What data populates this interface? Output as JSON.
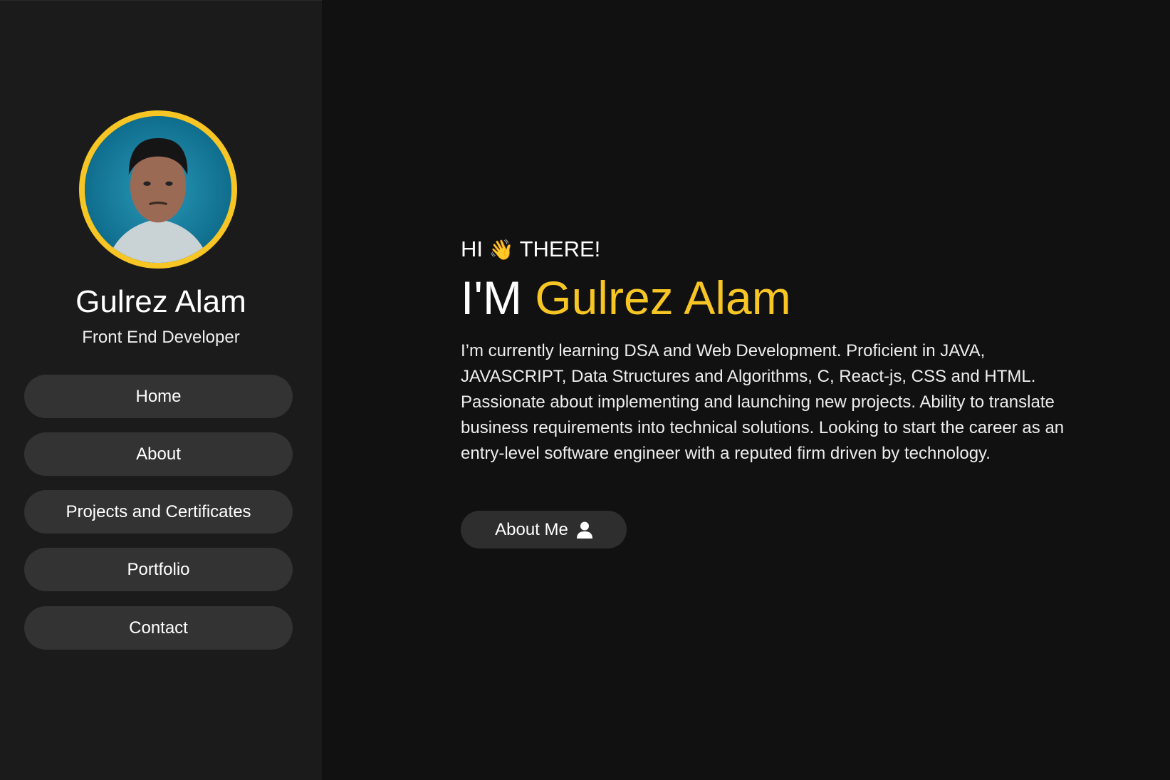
{
  "sidebar": {
    "name": "Gulrez Alam",
    "role": "Front End Developer",
    "nav": [
      "Home",
      "About",
      "Projects and Certificates",
      "Portfolio",
      "Contact"
    ]
  },
  "hero": {
    "greeting_start": "HI",
    "greeting_emoji": "👋",
    "greeting_end": "THERE!",
    "im": "I'M",
    "highlight_name": "Gulrez Alam",
    "description": "I’m currently learning DSA and Web Development. Proficient in JAVA, JAVASCRIPT, Data Structures and Algorithms, C, React-js, CSS and HTML. Passionate about implementing and launching new projects. Ability to translate business requirements into technical solutions. Looking to start the career as an entry-level software engineer with a reputed firm driven by technology.",
    "button_label": "About Me",
    "button_icon": "user-icon"
  },
  "colors": {
    "accent": "#f7c624",
    "sidebar_bg": "#1b1b1b",
    "main_bg": "#111111",
    "button_bg": "#333333"
  }
}
